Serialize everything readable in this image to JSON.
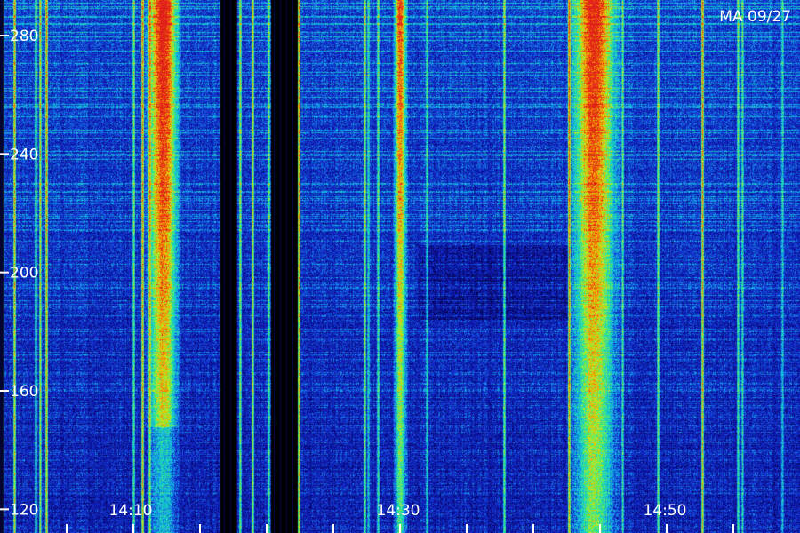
{
  "chart_data": {
    "type": "heatmap",
    "corner_label": "MA 09/27",
    "x_ticks": [
      "14:10",
      "14:30",
      "14:50"
    ],
    "y_ticks": [
      280,
      240,
      200,
      160,
      120
    ],
    "ylim": [
      112,
      292
    ],
    "colormap": [
      "#000000",
      "#0a0a8a",
      "#1433d6",
      "#12b4e6",
      "#22e4a0",
      "#b6f21c",
      "#ff9a00",
      "#e0201a"
    ],
    "bright_bands": [
      {
        "label_index": 0,
        "strength": 0.95
      },
      {
        "label_index": 1,
        "strength": 0.8
      },
      {
        "label_index": 2,
        "strength": 0.88
      }
    ]
  }
}
